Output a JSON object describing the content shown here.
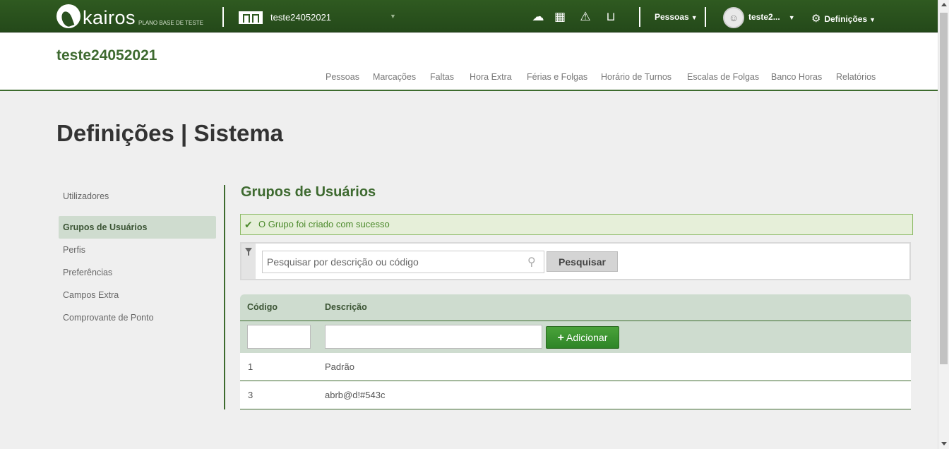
{
  "topbar": {
    "logo_text": "kairos",
    "logo_sub": "PLANO BASE DE TESTE",
    "company_name": "teste24052021",
    "people_menu": "Pessoas",
    "user_name": "teste2...",
    "settings_menu": "Definições",
    "icons": [
      "cloud-download-icon",
      "calculator-icon",
      "warning-icon",
      "inbox-icon"
    ]
  },
  "header": {
    "title": "teste24052021",
    "nav": [
      "Pessoas",
      "Marcações",
      "Faltas",
      "Hora Extra",
      "Férias e Folgas",
      "Horário de Turnos",
      "Escalas de Folgas",
      "Banco Horas",
      "Relatórios"
    ]
  },
  "page_title": "Definições | Sistema",
  "sidebar": {
    "items": [
      {
        "label": "Utilizadores",
        "active": false
      },
      {
        "label": "Grupos de Usuários",
        "active": true
      },
      {
        "label": "Perfis",
        "active": false
      },
      {
        "label": "Preferências",
        "active": false
      },
      {
        "label": "Campos Extra",
        "active": false
      },
      {
        "label": "Comprovante de Ponto",
        "active": false
      }
    ]
  },
  "main": {
    "title": "Grupos de Usuários",
    "alert": "O Grupo foi criado com sucesso",
    "search": {
      "placeholder": "Pesquisar por descrição ou código",
      "value": "",
      "button": "Pesquisar"
    },
    "table": {
      "columns": [
        "Código",
        "Descrição"
      ],
      "add_button": "Adicionar",
      "new_code": "",
      "new_description": "",
      "rows": [
        {
          "code": "1",
          "description": "Padrão"
        },
        {
          "code": "3",
          "description": "abrb@d!#543c"
        }
      ]
    }
  },
  "colors": {
    "brand_green": "#2f5a20",
    "accent_green": "#3e6a30",
    "success_bg": "#e6efd9",
    "table_header_bg": "#cedccf"
  }
}
